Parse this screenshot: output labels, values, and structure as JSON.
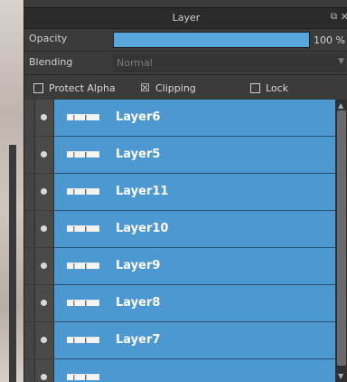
{
  "panel": {
    "title": "Layer",
    "popout_icon": "⧉",
    "close_icon": "✕"
  },
  "opacity": {
    "label": "Opacity",
    "value_text": "100 %",
    "fraction": 1.0
  },
  "blending": {
    "label": "Blending",
    "value": "Normal"
  },
  "options": {
    "protect_alpha": {
      "label": "Protect Alpha",
      "checked": false
    },
    "clipping": {
      "label": "Clipping",
      "checked": true,
      "mark": "☒"
    },
    "lock": {
      "label": "Lock",
      "checked": false
    }
  },
  "layers": [
    {
      "name": "Layer6"
    },
    {
      "name": "Layer5"
    },
    {
      "name": "Layer11"
    },
    {
      "name": "Layer10"
    },
    {
      "name": "Layer9"
    },
    {
      "name": "Layer8"
    },
    {
      "name": "Layer7"
    },
    {
      "name": ""
    }
  ],
  "colors": {
    "accent": "#59a6dc",
    "layer_row": "#4e98d2",
    "panel_bg": "#3b3b3b"
  }
}
